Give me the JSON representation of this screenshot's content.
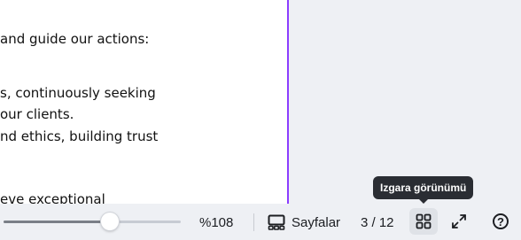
{
  "document": {
    "lines": [
      "and guide our actions:",
      "s, continuously seeking",
      " our clients.",
      "nd ethics, building trust",
      "eve exceptional"
    ]
  },
  "tooltip": {
    "text": "Izgara görünümü"
  },
  "footer": {
    "zoom": {
      "value_label": "%108",
      "slider_fraction": 0.6
    },
    "pages_button": {
      "label": "Sayfalar",
      "icon": "pages-icon"
    },
    "page_counter": "3 / 12",
    "grid_view_button": {
      "icon": "grid-icon"
    },
    "fullscreen_button": {
      "icon": "fullscreen-icon"
    },
    "help_button": {
      "icon": "help-icon",
      "glyph": "?"
    }
  },
  "colors": {
    "accent_border": "#8b3dff",
    "tooltip_bg": "#2a2d33",
    "bar_bg": "#eef0f4"
  }
}
